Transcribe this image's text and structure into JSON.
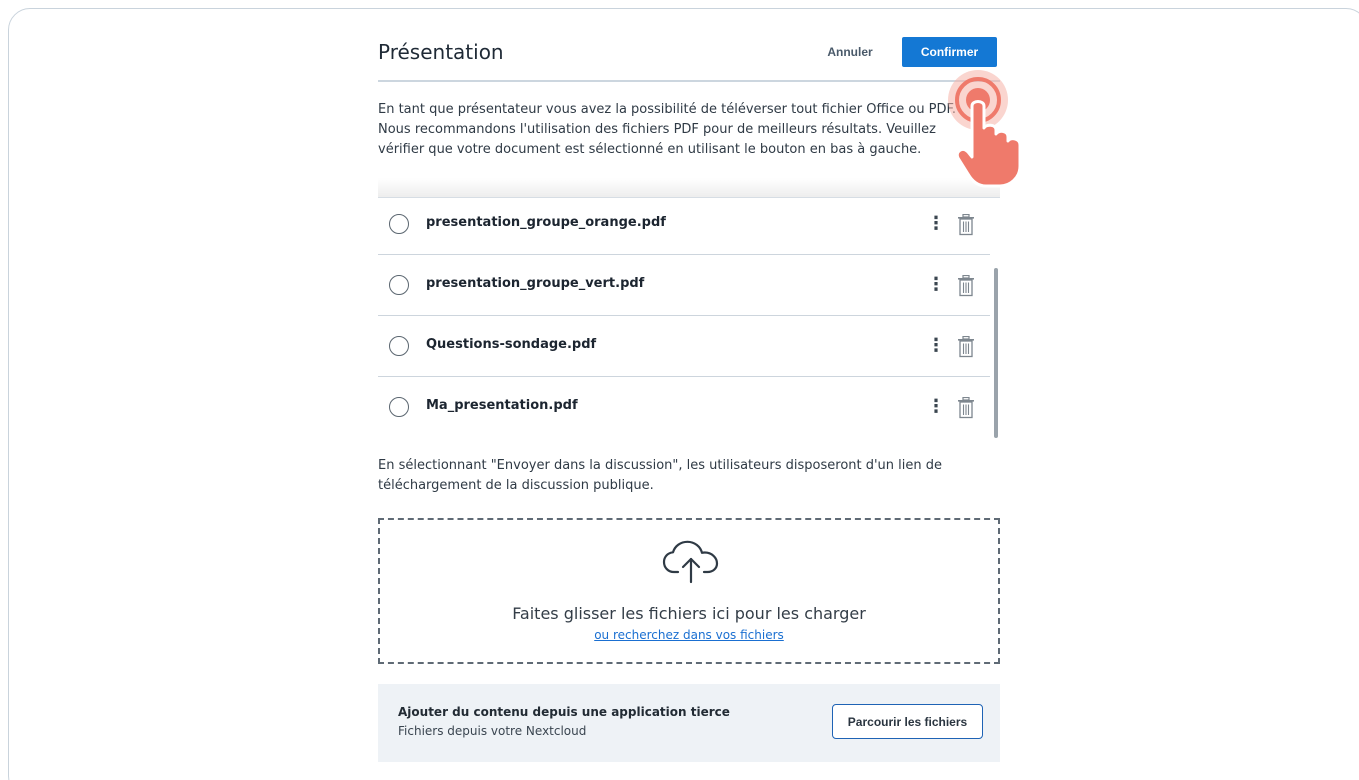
{
  "dialog": {
    "title": "Présentation",
    "cancel_label": "Annuler",
    "confirm_label": "Confirmer",
    "intro_text": "En tant que présentateur vous avez la possibilité de téléverser tout fichier Office ou PDF. Nous recommandons l'utilisation des fichiers PDF pour de meilleurs résultats. Veuillez vérifier que votre document est sélectionné en utilisant le bouton en bas à gauche.",
    "files": [
      {
        "name": "presentation_groupe_orange.pdf"
      },
      {
        "name": "presentation_groupe_vert.pdf"
      },
      {
        "name": "Questions-sondage.pdf"
      },
      {
        "name": "Ma_presentation.pdf"
      }
    ],
    "notice_text": "En sélectionnant \"Envoyer dans la discussion\", les utilisateurs disposeront d'un lien de téléchargement de la discussion publique.",
    "dropzone": {
      "text": "Faites glisser les fichiers ici pour les charger",
      "link": "ou recherchez dans vos fichiers"
    },
    "third_party": {
      "title": "Ajouter du contenu depuis une application tierce",
      "subtitle": "Fichiers depuis votre Nextcloud",
      "button_label": "Parcourir les fichiers"
    }
  },
  "icons": {
    "row_menu": "more-vertical-icon",
    "row_delete": "trash-icon",
    "upload": "cloud-upload-icon",
    "pointer": "tap-hand-icon"
  },
  "colors": {
    "primary": "#1478d4",
    "link": "#1a6fd1",
    "panel_bg": "#eef2f6",
    "pointer": "#ef7a6b"
  }
}
